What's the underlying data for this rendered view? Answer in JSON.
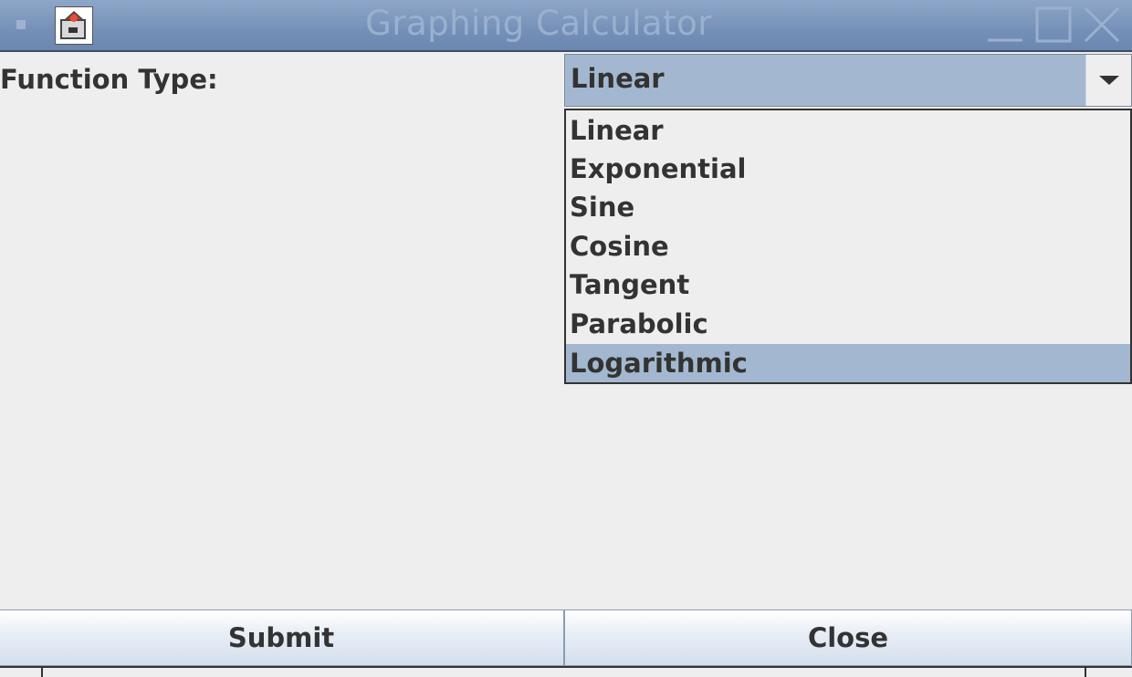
{
  "window": {
    "title": "Graphing Calculator",
    "icons": {
      "menu": "window-menu-icon",
      "app": "application-icon",
      "minimize": "minimize-icon",
      "maximize": "maximize-icon",
      "close": "close-icon"
    }
  },
  "form": {
    "function_type_label": "Function Type:",
    "function_type_selected": "Linear",
    "function_type_options": [
      "Linear",
      "Exponential",
      "Sine",
      "Cosine",
      "Tangent",
      "Parabolic",
      "Logarithmic"
    ],
    "highlighted_option": "Logarithmic"
  },
  "buttons": {
    "submit_label": "Submit",
    "close_label": "Close"
  },
  "colors": {
    "titlebar": "#7590b8",
    "selection": "#a3b8d0",
    "background": "#eeeeee",
    "text": "#333333"
  }
}
